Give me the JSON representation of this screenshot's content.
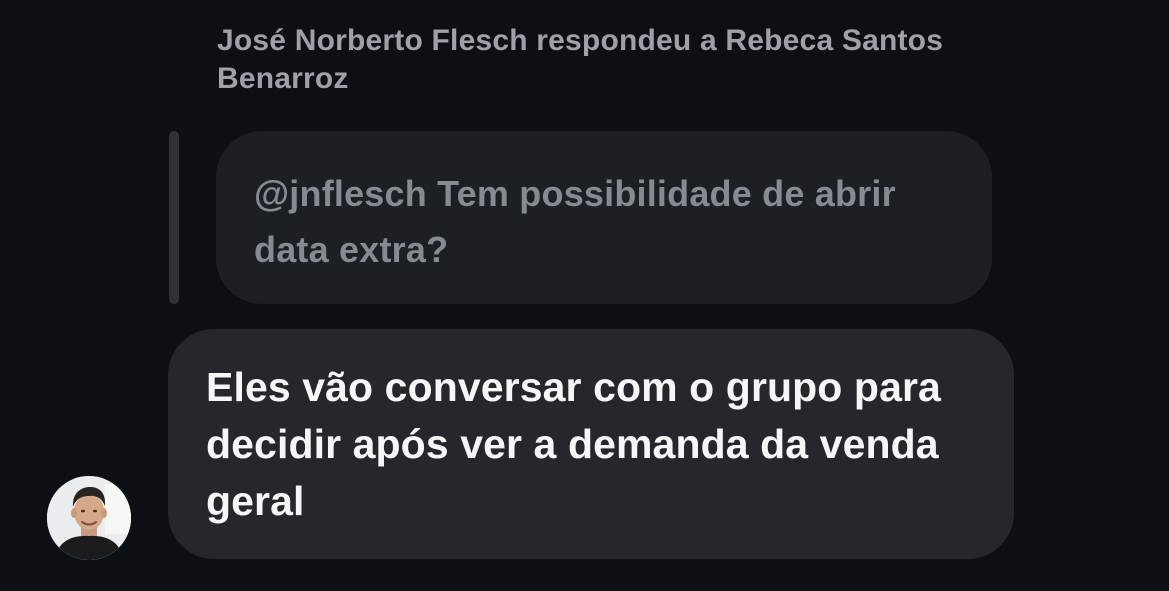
{
  "reply_context": {
    "header_text": "José Norberto Flesch respondeu a Rebeca Santos Benarroz"
  },
  "quoted_message": {
    "mention": "@jnflesch",
    "text": "Tem possibilidade de abrir data extra?"
  },
  "message": {
    "text": "Eles vão conversar com o grupo para decidir após ver a demanda da venda geral"
  },
  "avatar": {
    "icon": "user-avatar-photo"
  },
  "colors": {
    "background": "#0c0f13",
    "quoted_bubble": "#1c1f24",
    "message_bubble": "#24272c",
    "header_text": "#9ea2a8",
    "quoted_text": "#868a91",
    "message_text": "#f5f6f7"
  }
}
